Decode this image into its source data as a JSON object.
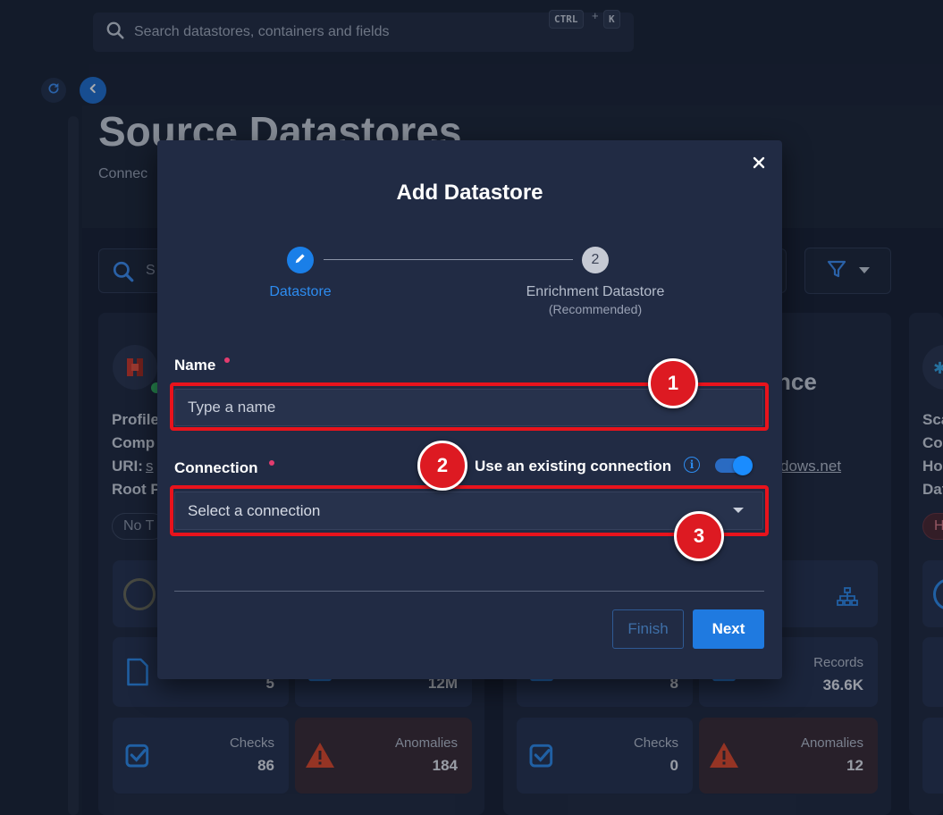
{
  "topbar": {
    "search_placeholder": "Search datastores, containers and fields",
    "shortcut_key1": "CTRL",
    "shortcut_plus": "+",
    "shortcut_key2": "K"
  },
  "background": {
    "page_title": "Source Datastores",
    "page_subtitle": "Connec",
    "search_placeholder": "S",
    "card1": {
      "labels": [
        "Profile",
        "Comp",
        "URI:",
        "Root P"
      ],
      "uri_link": "s",
      "chip": "No T",
      "tiles": {
        "files_value": "5",
        "records_value": "12M",
        "checks_label": "Checks",
        "checks_value": "86",
        "anomalies_label": "Anomalies",
        "anomalies_value": "184"
      }
    },
    "card2": {
      "title_fragment": "nce",
      "host_fragment": "dows.net",
      "tiles": {
        "tables_value": "8",
        "records_label": "Records",
        "records_value": "36.6K",
        "checks_label": "Checks",
        "checks_value": "0",
        "anomalies_label": "Anomalies",
        "anomalies_value": "12"
      }
    },
    "card3": {
      "labels": [
        "Sca",
        "Co",
        "Ho",
        "Dat"
      ],
      "chip": "H"
    }
  },
  "modal": {
    "title": "Add Datastore",
    "steps": [
      {
        "label": "Datastore",
        "state": "active"
      },
      {
        "number": "2",
        "label": "Enrichment Datastore",
        "sublabel": "(Recommended)",
        "state": "pending"
      }
    ],
    "name_field": {
      "label": "Name",
      "placeholder": "Type a name",
      "value": ""
    },
    "connection_field": {
      "label": "Connection",
      "selected": "Select a connection"
    },
    "existing_toggle": {
      "label": "Use an existing connection",
      "on": true
    },
    "buttons": {
      "finish": "Finish",
      "next": "Next"
    }
  },
  "annotations": [
    "1",
    "2",
    "3"
  ],
  "colors": {
    "accent": "#1f7ae0",
    "highlight": "#e8131c",
    "required": "#e43c6f"
  }
}
